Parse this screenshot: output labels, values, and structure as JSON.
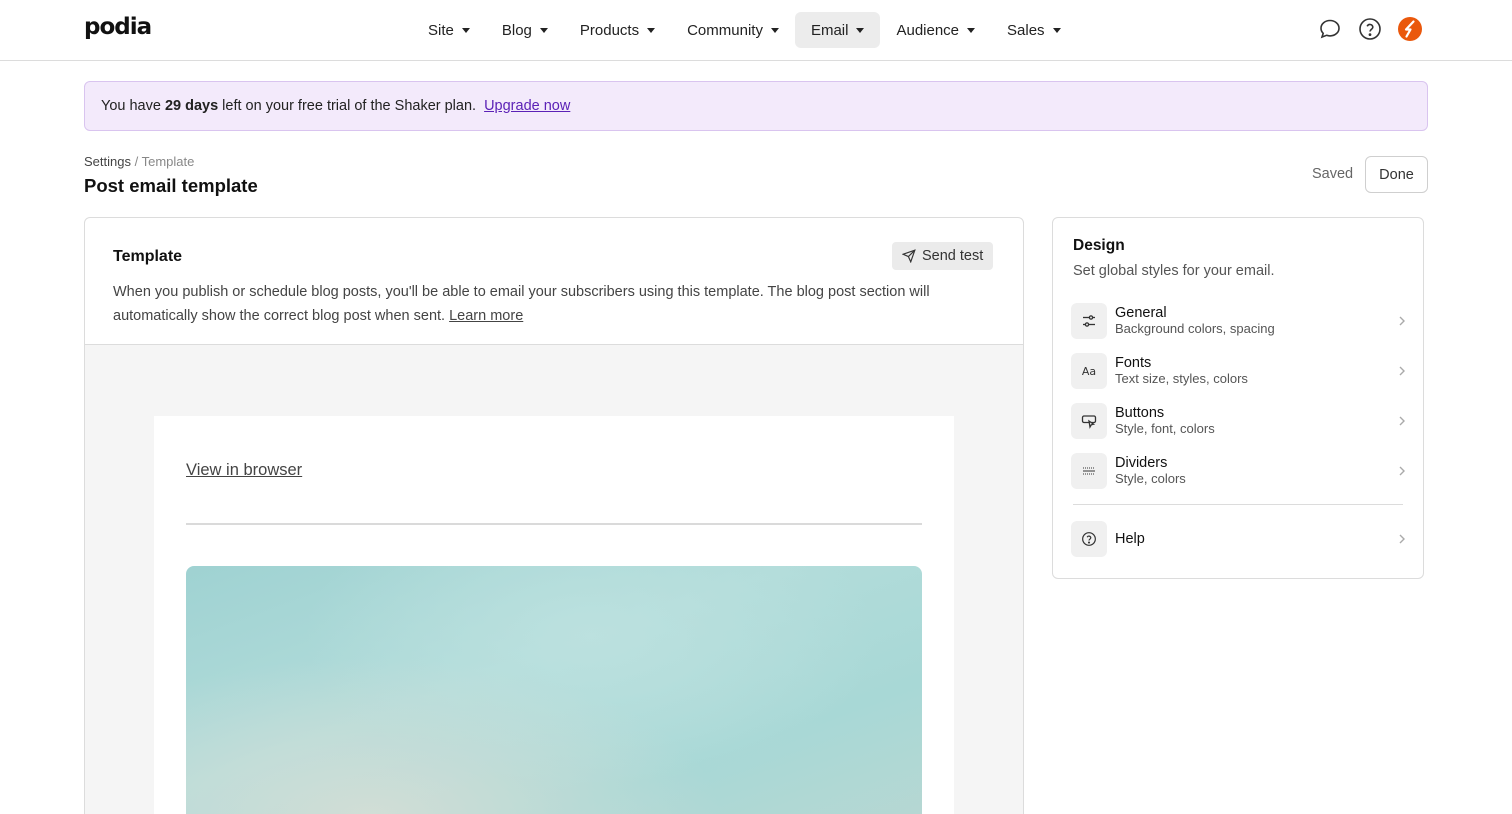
{
  "brand": {
    "logo_text": "podia",
    "accent": "#5b21b6",
    "avatar_color": "#ea580c"
  },
  "nav": {
    "items": [
      {
        "label": "Site"
      },
      {
        "label": "Blog"
      },
      {
        "label": "Products"
      },
      {
        "label": "Community"
      },
      {
        "label": "Email",
        "active": true
      },
      {
        "label": "Audience"
      },
      {
        "label": "Sales"
      }
    ],
    "icons": [
      "chat-icon",
      "help-icon",
      "avatar"
    ]
  },
  "banner": {
    "prefix": "You have",
    "days": "29 days",
    "suffix": "left on your free trial of the Shaker plan.",
    "link": "Upgrade now"
  },
  "breadcrumb": {
    "parent": "Settings",
    "separator": "/",
    "current": "Template"
  },
  "page": {
    "title": "Post email template",
    "status": "Saved",
    "done_label": "Done"
  },
  "template": {
    "title": "Template",
    "send_test_label": "Send test",
    "description": "When you publish or schedule blog posts, you'll be able to email your subscribers using this template. The blog post section will automatically show the correct blog post when sent.",
    "learn_more": "Learn more",
    "preview": {
      "view_in_browser": "View in browser"
    }
  },
  "design": {
    "title": "Design",
    "subtitle": "Set global styles for your email.",
    "options": [
      {
        "label": "General",
        "desc": "Background colors, spacing",
        "icon": "sliders-icon"
      },
      {
        "label": "Fonts",
        "desc": "Text size, styles, colors",
        "icon": "font-icon",
        "icon_text": "Aa"
      },
      {
        "label": "Buttons",
        "desc": "Style, font, colors",
        "icon": "button-cursor-icon"
      },
      {
        "label": "Dividers",
        "desc": "Style, colors",
        "icon": "divider-icon"
      }
    ],
    "help_label": "Help"
  }
}
